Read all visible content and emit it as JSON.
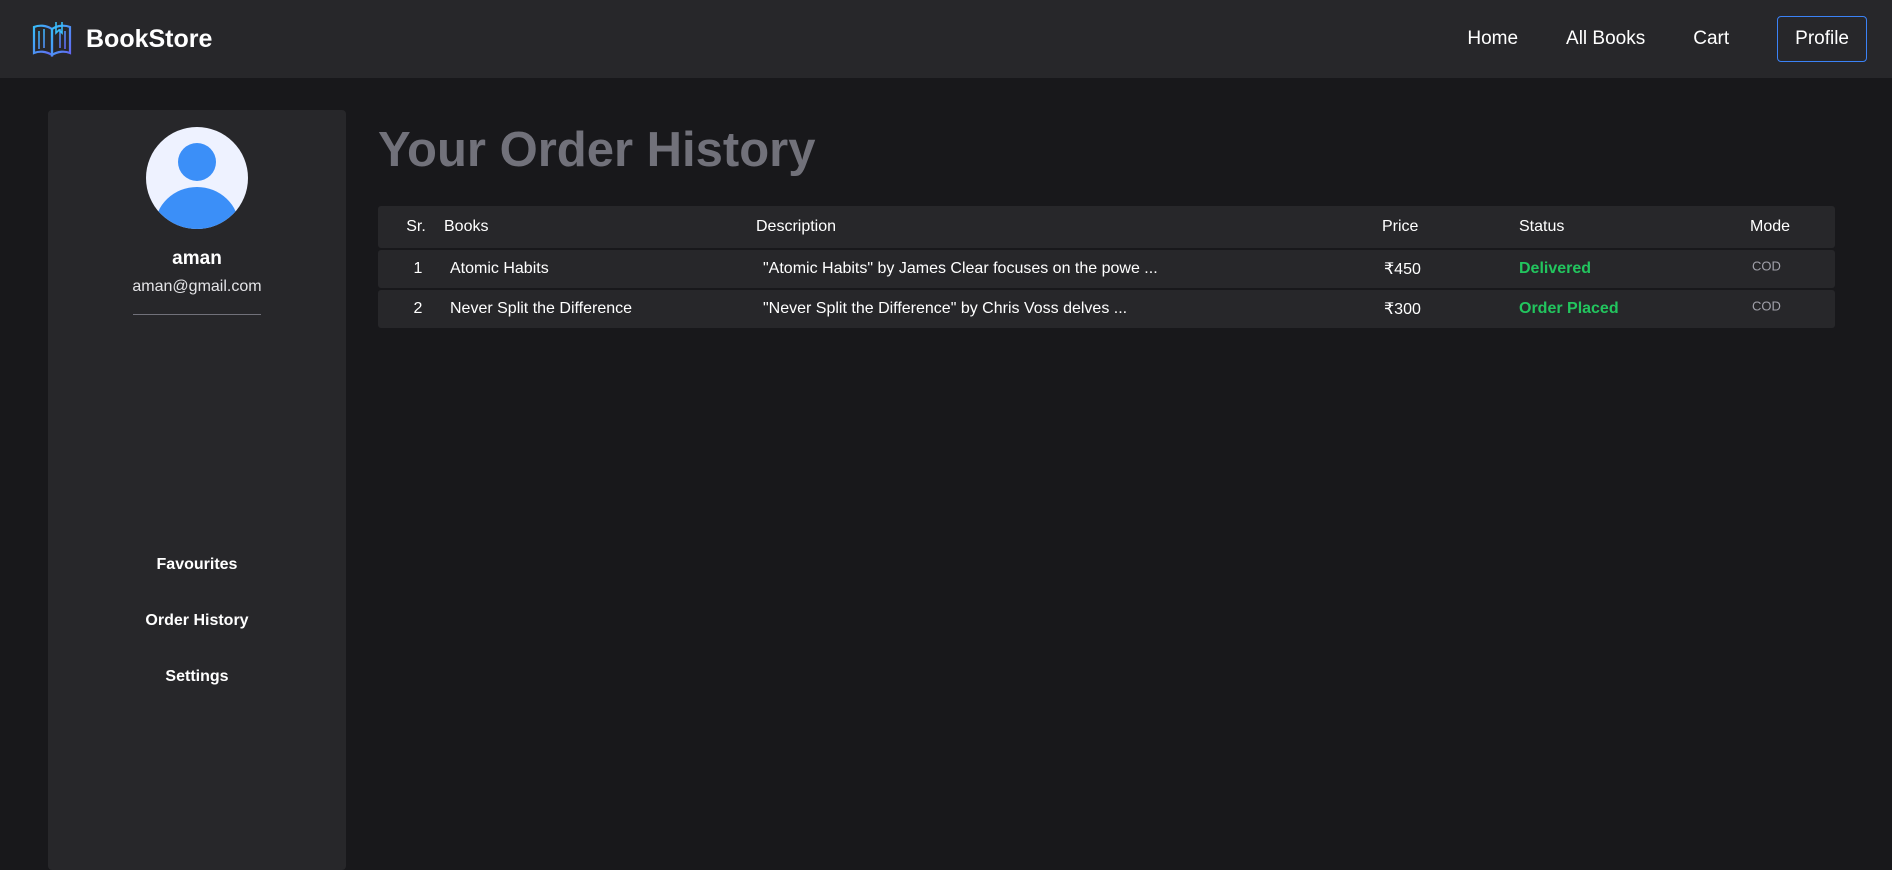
{
  "navbar": {
    "brand": "BookStore",
    "logo_icon": "open-book-icon",
    "links": [
      {
        "label": "Home"
      },
      {
        "label": "All Books"
      },
      {
        "label": "Cart"
      },
      {
        "label": "Profile"
      }
    ],
    "profile_border_color": "#3b82f6"
  },
  "sidebar": {
    "avatar_icon": "user-avatar-icon",
    "avatar_color": "#3b8ff8",
    "username": "aman",
    "email": "aman@gmail.com",
    "menu": [
      {
        "label": "Favourites"
      },
      {
        "label": "Order History"
      },
      {
        "label": "Settings"
      }
    ]
  },
  "main": {
    "title": "Your Order History",
    "table": {
      "headers": {
        "sr": "Sr.",
        "books": "Books",
        "description": "Description",
        "price": "Price",
        "status": "Status",
        "mode": "Mode"
      },
      "rows": [
        {
          "sr": "1",
          "book": "Atomic Habits",
          "description": "\"Atomic Habits\" by James Clear focuses on the powe ...",
          "price": "₹450",
          "status": "Delivered",
          "mode": "COD"
        },
        {
          "sr": "2",
          "book": "Never Split the Difference",
          "description": "\"Never Split the Difference\" by Chris Voss delves ...",
          "price": "₹300",
          "status": "Order Placed",
          "mode": "COD"
        }
      ],
      "status_color": "#22c55e"
    }
  }
}
